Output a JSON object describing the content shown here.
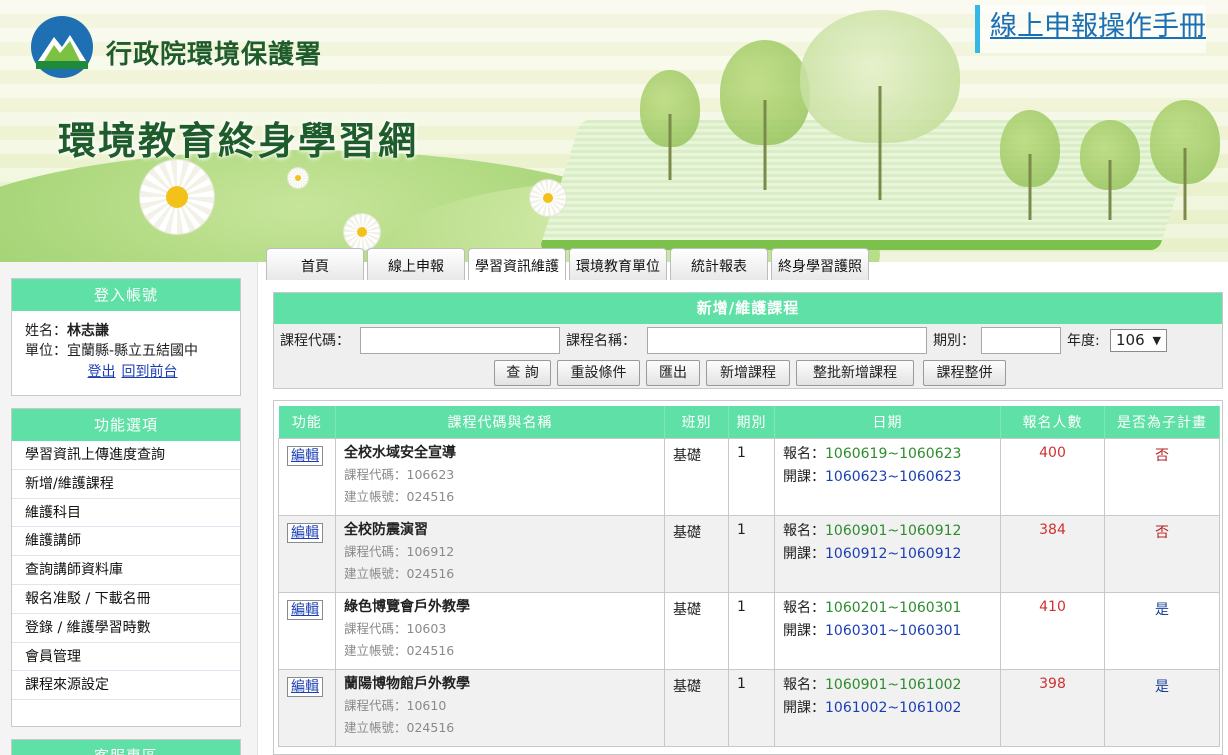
{
  "header": {
    "agency_name": "行政院環境保護署",
    "site_title": "環境教育終身學習網",
    "manual_link": "線上申報操作手冊"
  },
  "tabs": [
    "首頁",
    "線上申報",
    "學習資訊維護",
    "環境教育單位",
    "統計報表",
    "終身學習護照"
  ],
  "login": {
    "title": "登入帳號",
    "name_label": "姓名：",
    "name_value": "林志謙",
    "unit_label": "單位：",
    "unit_value": "宜蘭縣-縣立五結國中",
    "logout": "登出",
    "frontend": "回到前台"
  },
  "menu": {
    "title": "功能選項",
    "items": [
      "學習資訊上傳進度查詢",
      "新增/維護課程",
      "維護科目",
      "維護講師",
      "查詢講師資料庫",
      "報名准駁 / 下載名冊",
      "登錄 / 維護學習時數",
      "會員管理",
      "課程來源設定"
    ]
  },
  "service": {
    "title": "客服專區"
  },
  "form": {
    "title": "新增/維護課程",
    "code_label": "課程代碼：",
    "name_label": "課程名稱：",
    "term_label": "期別：",
    "year_label": "年度:",
    "year_value": "106",
    "buttons": [
      "查 詢",
      "重設條件",
      "匯出",
      "新增課程",
      "整批新增課程",
      "課程整併"
    ]
  },
  "table": {
    "headers": [
      "功能",
      "課程代碼與名稱",
      "班別",
      "期別",
      "日期",
      "報名人數",
      "是否為子計畫"
    ],
    "edit_label": "編輯",
    "code_prefix": "課程代碼：",
    "account_prefix": "建立帳號：",
    "reg_prefix": "報名：",
    "open_prefix": "開課：",
    "rows": [
      {
        "name": "全校水域安全宣導",
        "code": "106623",
        "account": "024516",
        "class": "基礎",
        "term": "1",
        "reg": "1060619~1060623",
        "open": "1060623~1060623",
        "count": "400",
        "sub": "否"
      },
      {
        "name": "全校防震演習",
        "code": "106912",
        "account": "024516",
        "class": "基礎",
        "term": "1",
        "reg": "1060901~1060912",
        "open": "1060912~1060912",
        "count": "384",
        "sub": "否"
      },
      {
        "name": "綠色博覽會戶外教學",
        "code": "10603",
        "account": "024516",
        "class": "基礎",
        "term": "1",
        "reg": "1060201~1060301",
        "open": "1060301~1060301",
        "count": "410",
        "sub": "是"
      },
      {
        "name": "蘭陽博物館戶外教學",
        "code": "10610",
        "account": "024516",
        "class": "基礎",
        "term": "1",
        "reg": "1060901~1061002",
        "open": "1061002~1061002",
        "count": "398",
        "sub": "是"
      }
    ]
  }
}
